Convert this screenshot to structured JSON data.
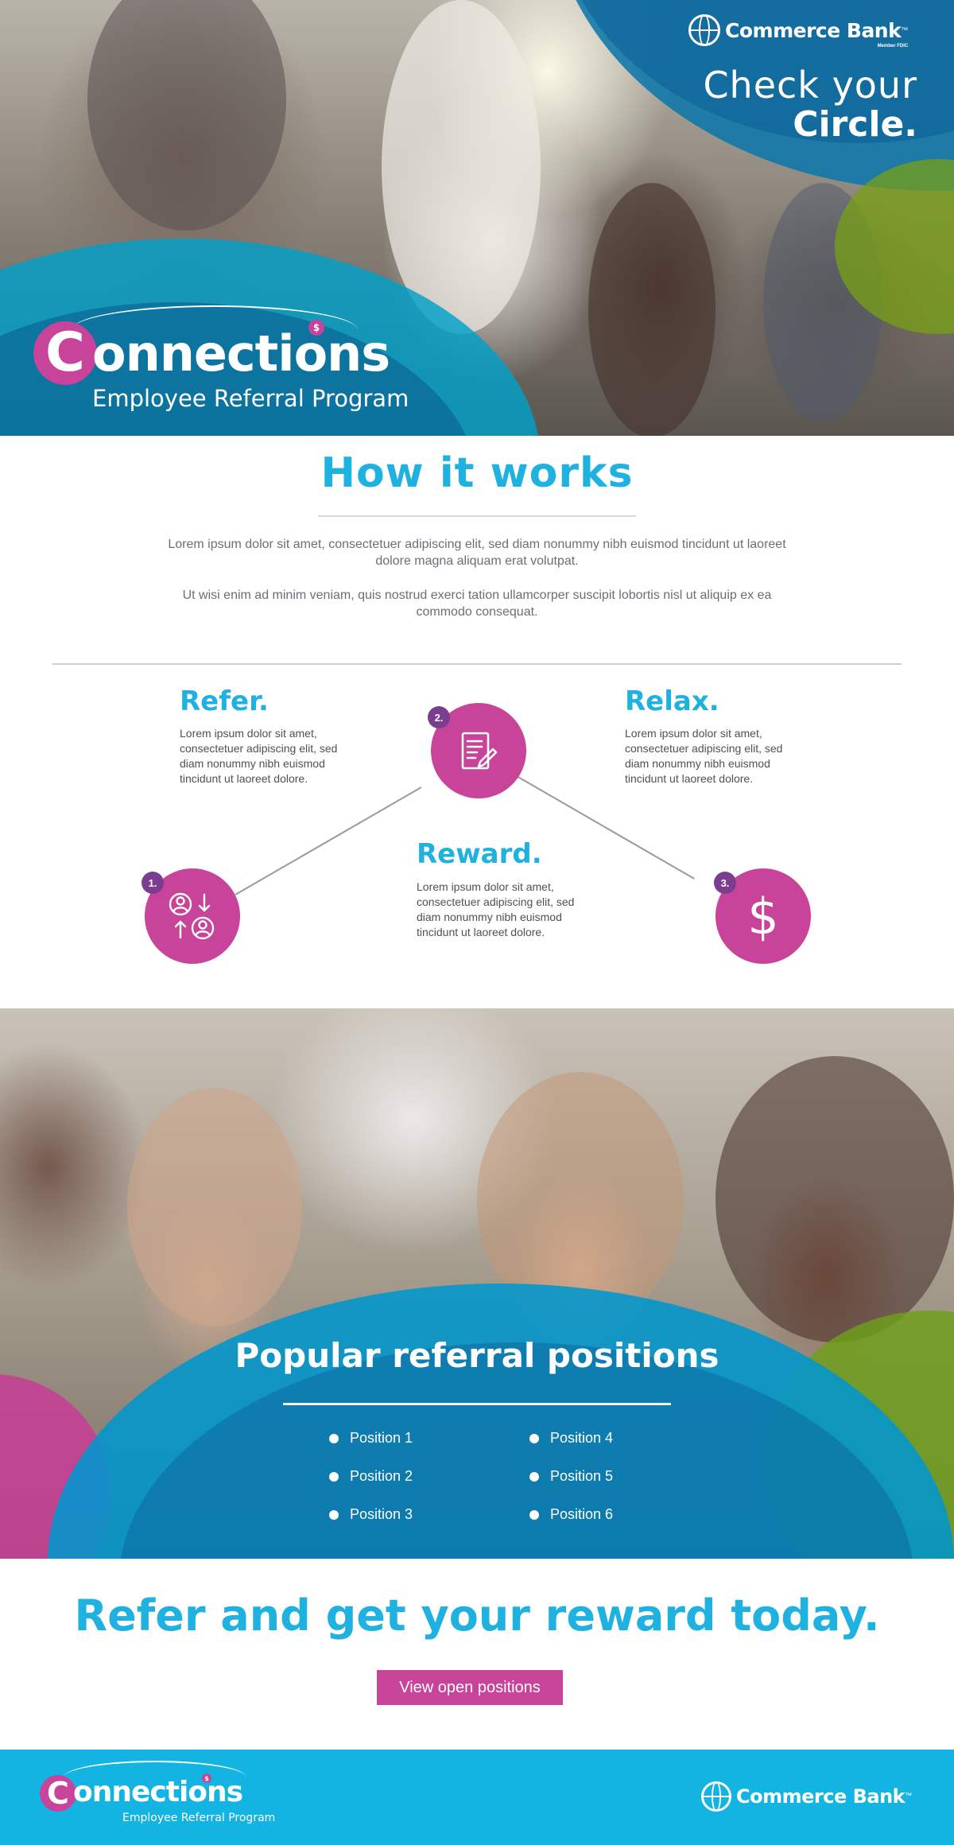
{
  "hero": {
    "bank_name": "Commerce Bank",
    "bank_tm": "™",
    "bank_sub": "Member FDIC",
    "tagline_line1": "Check your",
    "tagline_line2": "Circle.",
    "program_logo_c": "C",
    "program_logo_word": "onnections",
    "program_logo_dollar": "$",
    "program_subtitle": "Employee Referral Program"
  },
  "how": {
    "title": "How it works",
    "paragraph1": "Lorem ipsum dolor sit amet, consectetuer adipiscing elit, sed diam nonummy nibh euismod tincidunt ut laoreet dolore magna aliquam erat volutpat.",
    "paragraph2": "Ut wisi enim ad minim veniam, quis nostrud exerci tation ullamcorper suscipit lobortis nisl ut aliquip ex ea commodo consequat.",
    "steps": [
      {
        "title": "Refer.",
        "text": "Lorem ipsum dolor sit amet, consectetuer adipiscing elit, sed diam nonummy nibh euismod tincidunt ut laoreet dolore.",
        "number": "1.",
        "icon": "people-exchange-icon"
      },
      {
        "title": "Reward.",
        "text": "Lorem ipsum dolor sit amet, consectetuer adipiscing elit, sed diam nonummy nibh euismod tincidunt ut laoreet dolore.",
        "number": "2.",
        "icon": "document-pen-icon"
      },
      {
        "title": "Relax.",
        "text": "Lorem ipsum dolor sit amet, consectetuer adipiscing elit, sed diam nonummy nibh euismod tincidunt ut laoreet dolore.",
        "number": "3.",
        "icon": "dollar-icon"
      }
    ],
    "dollar_glyph": "$"
  },
  "positions": {
    "title": "Popular referral positions",
    "items": [
      "Position 1",
      "Position 2",
      "Position 3",
      "Position 4",
      "Position 5",
      "Position 6"
    ]
  },
  "cta": {
    "title": "Refer and get your reward today.",
    "button_label": "View open positions"
  },
  "footer": {
    "program_logo_c": "C",
    "program_logo_word": "onnections",
    "program_logo_dollar": "$",
    "program_subtitle": "Employee Referral Program",
    "bank_name": "Commerce Bank",
    "bank_tm": "™"
  },
  "colors": {
    "accent_blue": "#1fb1e0",
    "accent_pink": "#c8439a",
    "accent_purple": "#7a3d8f",
    "accent_green": "#7aa81c",
    "footer_blue": "#14b4e2"
  }
}
